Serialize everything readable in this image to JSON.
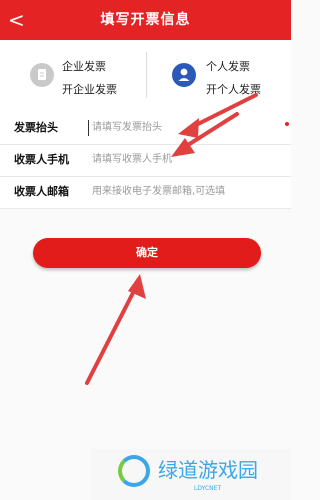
{
  "header": {
    "back_icon": "back-chevron-icon",
    "title": "填写开票信息",
    "color": "#e42424"
  },
  "invoice_types": [
    {
      "line1": "企业发票",
      "line2": "开企业发票",
      "icon": "document-icon"
    },
    {
      "line1": "个人发票",
      "line2": "开个人发票",
      "icon": "person-icon"
    }
  ],
  "form": {
    "title_label": "发票抬头",
    "title_placeholder": "请填写发票抬头",
    "phone_label": "收票人手机",
    "phone_placeholder": "请填写收票人手机",
    "email_label": "收票人邮箱",
    "email_placeholder": "用来接收电子发票邮箱,可选填"
  },
  "confirm_label": "确定",
  "watermark": {
    "text": "绿道游戏园",
    "sub": "LDYCNET"
  },
  "annotation_color": "#e04040"
}
